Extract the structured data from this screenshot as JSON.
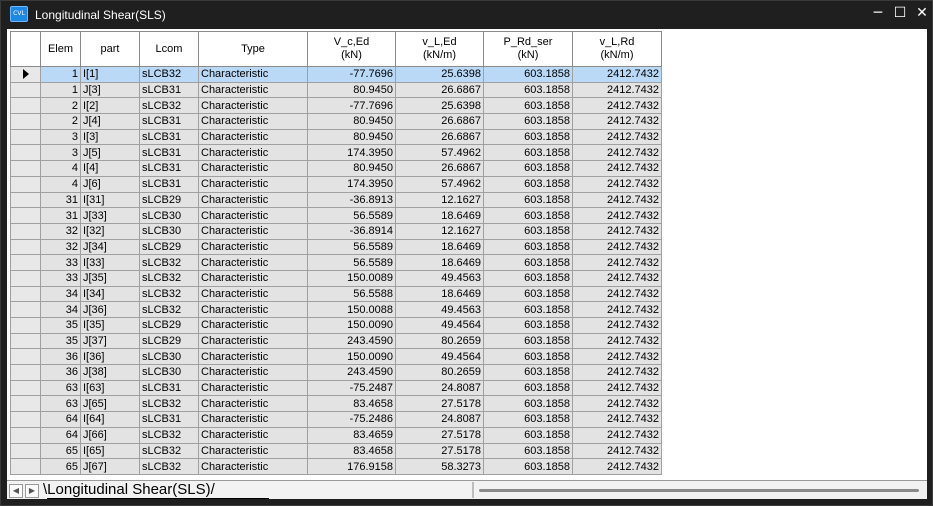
{
  "window": {
    "title": "Longitudinal Shear(SLS)",
    "icon_label": "CVL",
    "minimize": "─",
    "maximize": "☐",
    "close": "✕"
  },
  "columns": [
    {
      "key": "elem",
      "label": "Elem",
      "unit": ""
    },
    {
      "key": "part",
      "label": "part",
      "unit": ""
    },
    {
      "key": "lcom",
      "label": "Lcom",
      "unit": ""
    },
    {
      "key": "type",
      "label": "Type",
      "unit": ""
    },
    {
      "key": "vced",
      "label": "V_c,Ed",
      "unit": "(kN)"
    },
    {
      "key": "vled",
      "label": "v_L,Ed",
      "unit": "(kN/m)"
    },
    {
      "key": "prd",
      "label": "P_Rd_ser",
      "unit": "(kN)"
    },
    {
      "key": "vlrd",
      "label": "v_L,Rd",
      "unit": "(kN/m)"
    }
  ],
  "rows": [
    [
      "1",
      "I[1]",
      "sLCB32",
      "Characteristic",
      "-77.7696",
      "25.6398",
      "603.1858",
      "2412.7432"
    ],
    [
      "1",
      "J[3]",
      "sLCB31",
      "Characteristic",
      "80.9450",
      "26.6867",
      "603.1858",
      "2412.7432"
    ],
    [
      "2",
      "I[2]",
      "sLCB32",
      "Characteristic",
      "-77.7696",
      "25.6398",
      "603.1858",
      "2412.7432"
    ],
    [
      "2",
      "J[4]",
      "sLCB31",
      "Characteristic",
      "80.9450",
      "26.6867",
      "603.1858",
      "2412.7432"
    ],
    [
      "3",
      "I[3]",
      "sLCB31",
      "Characteristic",
      "80.9450",
      "26.6867",
      "603.1858",
      "2412.7432"
    ],
    [
      "3",
      "J[5]",
      "sLCB31",
      "Characteristic",
      "174.3950",
      "57.4962",
      "603.1858",
      "2412.7432"
    ],
    [
      "4",
      "I[4]",
      "sLCB31",
      "Characteristic",
      "80.9450",
      "26.6867",
      "603.1858",
      "2412.7432"
    ],
    [
      "4",
      "J[6]",
      "sLCB31",
      "Characteristic",
      "174.3950",
      "57.4962",
      "603.1858",
      "2412.7432"
    ],
    [
      "31",
      "I[31]",
      "sLCB29",
      "Characteristic",
      "-36.8913",
      "12.1627",
      "603.1858",
      "2412.7432"
    ],
    [
      "31",
      "J[33]",
      "sLCB30",
      "Characteristic",
      "56.5589",
      "18.6469",
      "603.1858",
      "2412.7432"
    ],
    [
      "32",
      "I[32]",
      "sLCB30",
      "Characteristic",
      "-36.8914",
      "12.1627",
      "603.1858",
      "2412.7432"
    ],
    [
      "32",
      "J[34]",
      "sLCB29",
      "Characteristic",
      "56.5589",
      "18.6469",
      "603.1858",
      "2412.7432"
    ],
    [
      "33",
      "I[33]",
      "sLCB32",
      "Characteristic",
      "56.5589",
      "18.6469",
      "603.1858",
      "2412.7432"
    ],
    [
      "33",
      "J[35]",
      "sLCB32",
      "Characteristic",
      "150.0089",
      "49.4563",
      "603.1858",
      "2412.7432"
    ],
    [
      "34",
      "I[34]",
      "sLCB32",
      "Characteristic",
      "56.5588",
      "18.6469",
      "603.1858",
      "2412.7432"
    ],
    [
      "34",
      "J[36]",
      "sLCB32",
      "Characteristic",
      "150.0088",
      "49.4563",
      "603.1858",
      "2412.7432"
    ],
    [
      "35",
      "I[35]",
      "sLCB29",
      "Characteristic",
      "150.0090",
      "49.4564",
      "603.1858",
      "2412.7432"
    ],
    [
      "35",
      "J[37]",
      "sLCB29",
      "Characteristic",
      "243.4590",
      "80.2659",
      "603.1858",
      "2412.7432"
    ],
    [
      "36",
      "I[36]",
      "sLCB30",
      "Characteristic",
      "150.0090",
      "49.4564",
      "603.1858",
      "2412.7432"
    ],
    [
      "36",
      "J[38]",
      "sLCB30",
      "Characteristic",
      "243.4590",
      "80.2659",
      "603.1858",
      "2412.7432"
    ],
    [
      "63",
      "I[63]",
      "sLCB31",
      "Characteristic",
      "-75.2487",
      "24.8087",
      "603.1858",
      "2412.7432"
    ],
    [
      "63",
      "J[65]",
      "sLCB32",
      "Characteristic",
      "83.4658",
      "27.5178",
      "603.1858",
      "2412.7432"
    ],
    [
      "64",
      "I[64]",
      "sLCB31",
      "Characteristic",
      "-75.2486",
      "24.8087",
      "603.1858",
      "2412.7432"
    ],
    [
      "64",
      "J[66]",
      "sLCB32",
      "Characteristic",
      "83.4659",
      "27.5178",
      "603.1858",
      "2412.7432"
    ],
    [
      "65",
      "I[65]",
      "sLCB32",
      "Characteristic",
      "83.4658",
      "27.5178",
      "603.1858",
      "2412.7432"
    ],
    [
      "65",
      "J[67]",
      "sLCB32",
      "Characteristic",
      "176.9158",
      "58.3273",
      "603.1858",
      "2412.7432"
    ]
  ],
  "selected_row": 0,
  "bottom": {
    "nav_prev": "◀",
    "nav_next": "▶",
    "sheet_tab": "\\Longitudinal Shear(SLS)/"
  }
}
